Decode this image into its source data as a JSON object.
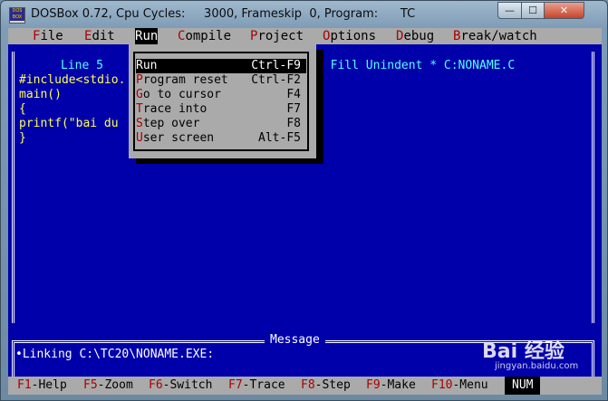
{
  "window": {
    "title": "DOSBox 0.72, Cpu Cycles:     3000, Frameskip  0, Program:      TC",
    "icon_text_top": "DOS",
    "icon_text_bottom": "BOX",
    "minimize_label": "—",
    "maximize_label": "☐",
    "close_label": "✕"
  },
  "menubar": [
    {
      "hot": "F",
      "rest": "ile"
    },
    {
      "hot": "E",
      "rest": "dit"
    },
    {
      "hot": "R",
      "rest": "un"
    },
    {
      "hot": "C",
      "rest": "ompile"
    },
    {
      "hot": "P",
      "rest": "roject"
    },
    {
      "hot": "O",
      "rest": "ptions"
    },
    {
      "hot": "D",
      "rest": "ebug"
    },
    {
      "hot": "B",
      "rest": "reak/watch"
    }
  ],
  "editor": {
    "status_left": "Line 5",
    "status_right": "b Fill Unindent * C:NONAME.C",
    "lines": [
      "#include<stdio.",
      "main()",
      "{",
      "printf(\"bai du",
      "}"
    ]
  },
  "run_menu": [
    {
      "hot": "R",
      "rest": "un",
      "shortcut": "Ctrl-F9"
    },
    {
      "hot": "P",
      "rest": "rogram reset",
      "shortcut": "Ctrl-F2"
    },
    {
      "hot": "G",
      "rest": "o to cursor",
      "shortcut": "F4"
    },
    {
      "hot": "T",
      "rest": "race into",
      "shortcut": "F7"
    },
    {
      "hot": "S",
      "rest": "tep over",
      "shortcut": "F8"
    },
    {
      "hot": "U",
      "rest": "ser screen",
      "shortcut": "Alt-F5"
    }
  ],
  "message": {
    "title": "Message",
    "text": "•Linking C:\\TC20\\NONAME.EXE:"
  },
  "fkeys": [
    {
      "key": "F1",
      "label": "-Help"
    },
    {
      "key": "F5",
      "label": "-Zoom"
    },
    {
      "key": "F6",
      "label": "-Switch"
    },
    {
      "key": "F7",
      "label": "-Trace"
    },
    {
      "key": "F8",
      "label": "-Step"
    },
    {
      "key": "F9",
      "label": "-Make"
    },
    {
      "key": "F10",
      "label": "-Menu"
    }
  ],
  "num_indicator": "NUM",
  "watermark": {
    "logo": "Bai 经验",
    "url": "jingyan.baidu.com"
  }
}
